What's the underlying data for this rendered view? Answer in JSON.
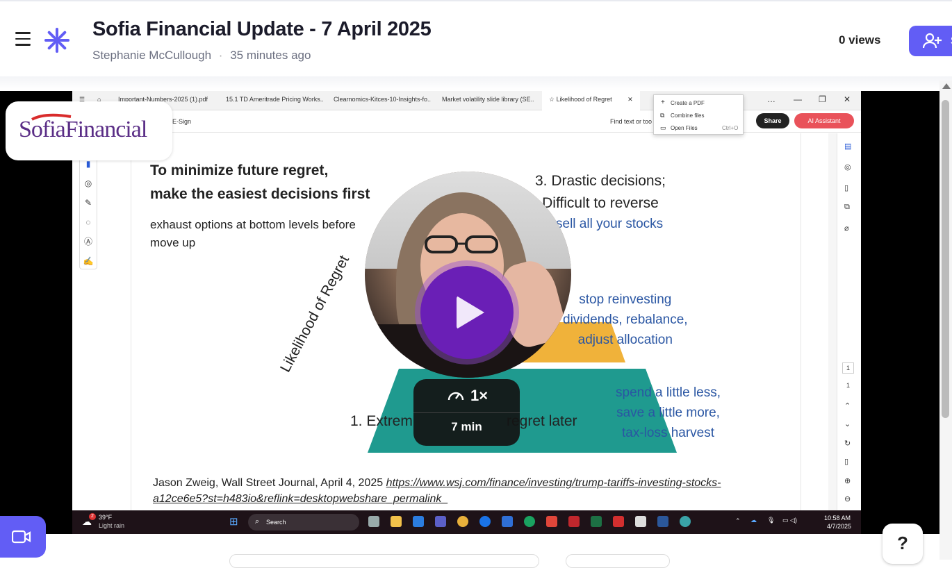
{
  "header": {
    "title": "Sofia Financial Update - 7 April 2025",
    "author": "Stephanie McCullough",
    "separator": "·",
    "time_ago": "35 minutes ago",
    "views": "0 views",
    "invite_label": "S",
    "accent": "#625df5"
  },
  "logo_overlay": {
    "text": "SofiaFinancial"
  },
  "browser": {
    "tabs": [
      "Important-Numbers-2025 (1).pdf",
      "15.1 TD Ameritrade Pricing Works..",
      "Clearnomics-Kitces-10-Insights-fo..",
      "Market volatility slide library (SE..",
      "Likelihood of Regret"
    ],
    "window_controls": [
      "…",
      "—",
      "❐",
      "✕"
    ],
    "toolbar_left": "E-Sign",
    "find_placeholder": "Find text or too",
    "share": "Share",
    "ai_assistant": "AI Assistant",
    "menu": [
      {
        "label": "Create a PDF",
        "shortcut": ""
      },
      {
        "label": "Combine files",
        "shortcut": ""
      },
      {
        "label": "Open Files",
        "shortcut": "Ctrl+O"
      }
    ],
    "page_current": "1",
    "page_total": "1"
  },
  "slide": {
    "heading_line1": "To minimize future regret,",
    "heading_line2": "make the easiest decisions first",
    "sub_line1": "exhaust options at bottom levels before",
    "sub_line2": "move up",
    "level3_line1": "3. Drastic decisions;",
    "level3_line2": "Difficult to reverse",
    "level3_action": "sell all your stocks",
    "level2_line1": "stop reinvesting",
    "level2_line2": "dividends, rebalance,",
    "level2_line3": "adjust allocation",
    "level1_line1": "spend a little less,",
    "level1_line2": "save a little more,",
    "level1_line3": "tax-loss harvest",
    "level1_label_left": "1. Extrem",
    "level1_label_right": "regret later",
    "axis_label": "Likelihood of Regret",
    "citation_text": "Jason Zweig, Wall Street Journal, April 4, 2025 ",
    "citation_link_line1": "https://www.wsj.com/finance/investing/trump-tariffs-investing-stocks-",
    "citation_link_line2": "a12ce6e5?st=h483io&reflink=desktopwebshare_permalink_",
    "teal": "#1f9a8f",
    "gold": "#f0b23a"
  },
  "taskbar": {
    "weather_temp": "39°F",
    "weather_desc": "Light rain",
    "weather_badge": "2",
    "search": "Search",
    "time": "10:58 AM",
    "date": "4/7/2025"
  },
  "playback": {
    "speed": "1×",
    "duration": "7 min",
    "play_color": "#6a1fb6"
  },
  "help": {
    "label": "?"
  }
}
